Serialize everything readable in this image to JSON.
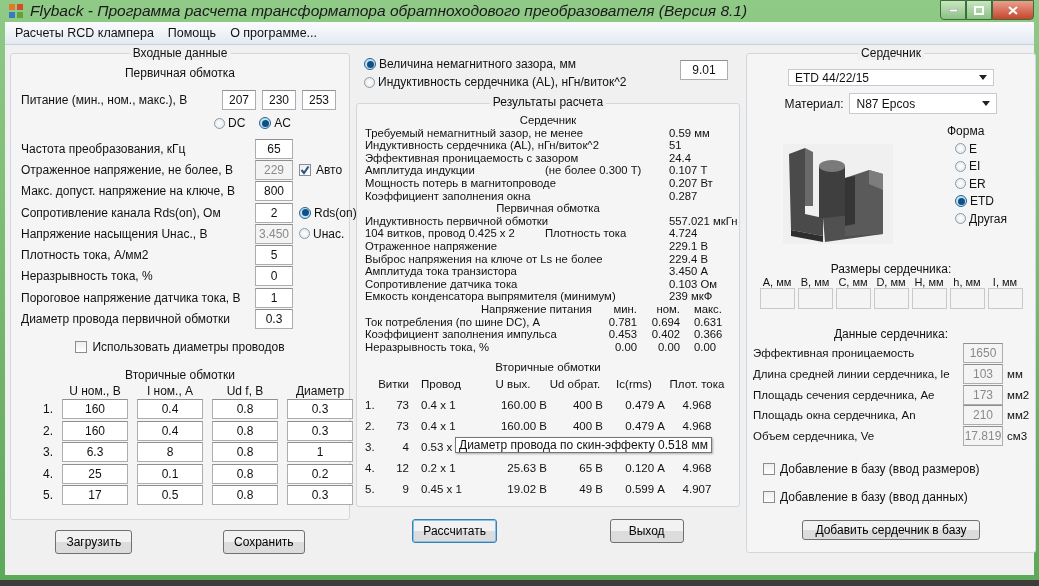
{
  "window": {
    "title": "Flyback - Программа расчета трансформатора обратноходового преобразователя (Версия 8.1)"
  },
  "menu": [
    "Расчеты RCD клампера",
    "Помощь",
    "О программе..."
  ],
  "input_panel": {
    "title": "Входные данные",
    "primary_title": "Первичная обмотка",
    "supply": {
      "label": "Питание (мин., ном., макс.), В",
      "values": [
        "207",
        "230",
        "253"
      ]
    },
    "current_type": [
      {
        "label": "DC",
        "selected": false
      },
      {
        "label": "AC",
        "selected": true
      }
    ],
    "params": [
      {
        "label": "Частота преобразования, кГц",
        "value": "65",
        "disabled": false
      },
      {
        "label": "Отраженное напряжение, не более, В",
        "value": "229",
        "disabled": true,
        "option": {
          "kind": "checkbox",
          "label": "Авто",
          "checked": true
        }
      },
      {
        "label": "Макс. допуст. напряжение на ключе, В",
        "value": "800",
        "disabled": false
      },
      {
        "label": "Сопротивление канала Rds(on), Ом",
        "value": "2",
        "disabled": false,
        "option": {
          "kind": "radio",
          "label": "Rds(on)",
          "selected": true
        }
      },
      {
        "label": "Напряжение насыщения Uнас., В",
        "value": "3.450",
        "disabled": true,
        "option": {
          "kind": "radio",
          "label": "Uнас.",
          "selected": false
        }
      },
      {
        "label": "Плотность тока, А/мм2",
        "value": "5",
        "disabled": false
      },
      {
        "label": "Неразрывность тока, %",
        "value": "0",
        "disabled": false
      },
      {
        "label": "Пороговое напряжение датчика тока, В",
        "value": "1",
        "disabled": false
      },
      {
        "label": "Диаметр провода первичной обмотки",
        "value": "0.3",
        "disabled": false
      }
    ],
    "use_diameters": {
      "label": "Использовать диаметры проводов",
      "checked": false
    },
    "secondary": {
      "title": "Вторичные обмотки",
      "columns": [
        "U ном., В",
        "I ном., А",
        "Ud f, В",
        "Диаметр"
      ],
      "rows": [
        {
          "number": "1.",
          "values": [
            "160",
            "0.4",
            "0.8",
            "0.3"
          ]
        },
        {
          "number": "2.",
          "values": [
            "160",
            "0.4",
            "0.8",
            "0.3"
          ]
        },
        {
          "number": "3.",
          "values": [
            "6.3",
            "8",
            "0.8",
            "1"
          ]
        },
        {
          "number": "4.",
          "values": [
            "25",
            "0.1",
            "0.8",
            "0.2"
          ]
        },
        {
          "number": "5.",
          "values": [
            "17",
            "0.5",
            "0.8",
            "0.3"
          ]
        }
      ]
    }
  },
  "left_buttons": [
    "Загрузить",
    "Сохранить"
  ],
  "gap_mode": [
    {
      "label": "Величина немагнитного зазора, мм",
      "selected": true
    },
    {
      "label": "Индуктивность сердечника (AL), нГн/виток^2",
      "selected": false
    }
  ],
  "gap_value": "9.01",
  "results": {
    "title": "Результаты расчета",
    "core_title": "Сердечник",
    "core_rows": [
      {
        "label": "Требуемый немагнитный зазор, не менее",
        "value": "0.59 мм"
      },
      {
        "label": "Индуктивность сердечника (AL), нГн/виток^2",
        "value": "51"
      },
      {
        "label": "Эффективная проницаемость с зазором",
        "value": "24.4"
      },
      {
        "label": "Амплитуда индукции",
        "note": "(не более 0.300 Т)",
        "value": "0.107 Т"
      },
      {
        "label": "Мощность потерь в магнитопроводе",
        "value": "0.207 Вт"
      },
      {
        "label": "Коэффициент заполнения окна",
        "value": "0.287"
      }
    ],
    "primary_title": "Первичная обмотка",
    "primary_rows": [
      {
        "label": "Индуктивность первичной обмотки",
        "value": "557.021 мкГн"
      },
      {
        "label": "104 витков, провод 0.425 x 2",
        "note": "Плотность тока",
        "value": "4.724"
      },
      {
        "label": "Отраженное напряжение",
        "value": "229.1 В"
      },
      {
        "label": "Выброс напряжения на ключе от Ls не более",
        "value": "229.4 В"
      },
      {
        "label": "Амплитуда тока транзистора",
        "value": "3.450 А"
      },
      {
        "label": "Сопротивление датчика тока",
        "value": "0.103 Ом"
      },
      {
        "label": "Емкость конденсатора выпрямителя (минимум)",
        "value": "239 мкФ"
      }
    ],
    "supply_columns": [
      "Напряжение питания",
      "мин.",
      "ном.",
      "макс."
    ],
    "supply_rows": [
      {
        "label": "Ток потребления (по шине DC), А",
        "values": [
          "0.781",
          "0.694",
          "0.631"
        ]
      },
      {
        "label": "Коэффициент заполнения импульса",
        "values": [
          "0.453",
          "0.402",
          "0.366"
        ]
      },
      {
        "label": "Неразрывность тока, %",
        "values": [
          "0.00",
          "0.00",
          "0.00"
        ]
      }
    ],
    "secondary_title": "Вторичные обмотки",
    "secondary_columns": [
      "Витки",
      "Провод",
      "U вых.",
      "Ud обрат.",
      "Ic(rms)",
      "Плот. тока"
    ],
    "secondary_rows": [
      {
        "number": "1.",
        "cells": [
          "73",
          "0.4 x 1",
          "160.00 В",
          "400 В",
          "0.479 А",
          "4.968"
        ]
      },
      {
        "number": "2.",
        "cells": [
          "73",
          "0.4 x 1",
          "160.00 В",
          "400 В",
          "0.479 А",
          "4.968"
        ]
      },
      {
        "number": "3.",
        "cells": [
          "4",
          "0.53 x"
        ]
      },
      {
        "number": "4.",
        "cells": [
          "12",
          "0.2 x 1",
          "25.63 В",
          "65 В",
          "0.120 А",
          "4.968"
        ]
      },
      {
        "number": "5.",
        "cells": [
          "9",
          "0.45 x 1",
          "19.02 В",
          "49 В",
          "0.599 А",
          "4.907"
        ]
      }
    ],
    "tooltip": "Диаметр провода по скин-эффекту 0.518 мм"
  },
  "middle_buttons": [
    {
      "label": "Рассчитать",
      "focused": true
    },
    {
      "label": "Выход",
      "focused": false
    }
  ],
  "core": {
    "title": "Сердечник",
    "core_select": "ETD 44/22/15",
    "material_label": "Материал:",
    "material": "N87 Epcos",
    "shape_title": "Форма",
    "shapes": [
      {
        "label": "E",
        "selected": false
      },
      {
        "label": "EI",
        "selected": false
      },
      {
        "label": "ER",
        "selected": false
      },
      {
        "label": "ETD",
        "selected": true
      },
      {
        "label": "Другая",
        "selected": false
      }
    ],
    "dims_title": "Размеры сердечника:",
    "dims": [
      "A, мм",
      "B, мм",
      "C, мм",
      "D, мм",
      "H, мм",
      "h, мм",
      "I, мм"
    ],
    "data_title": "Данные сердечника:",
    "data_rows": [
      {
        "label": "Эффективная проницаемость",
        "value": "1650"
      },
      {
        "label": "Длина средней линии сердечника, le",
        "value": "103",
        "unit": "мм"
      },
      {
        "label": "Площадь сечения сердечника, Ae",
        "value": "173",
        "unit": "мм2"
      },
      {
        "label": "Площадь окна сердечника, An",
        "value": "210",
        "unit": "мм2"
      },
      {
        "label": "Объем сердечника, Ve",
        "value": "17.819",
        "unit": "см3"
      }
    ],
    "checks": [
      {
        "label": "Добавление в базу (ввод размеров)",
        "checked": false
      },
      {
        "label": "Добавление в базу (ввод данных)",
        "checked": false
      }
    ],
    "add_button": "Добавить сердечник в базу"
  }
}
